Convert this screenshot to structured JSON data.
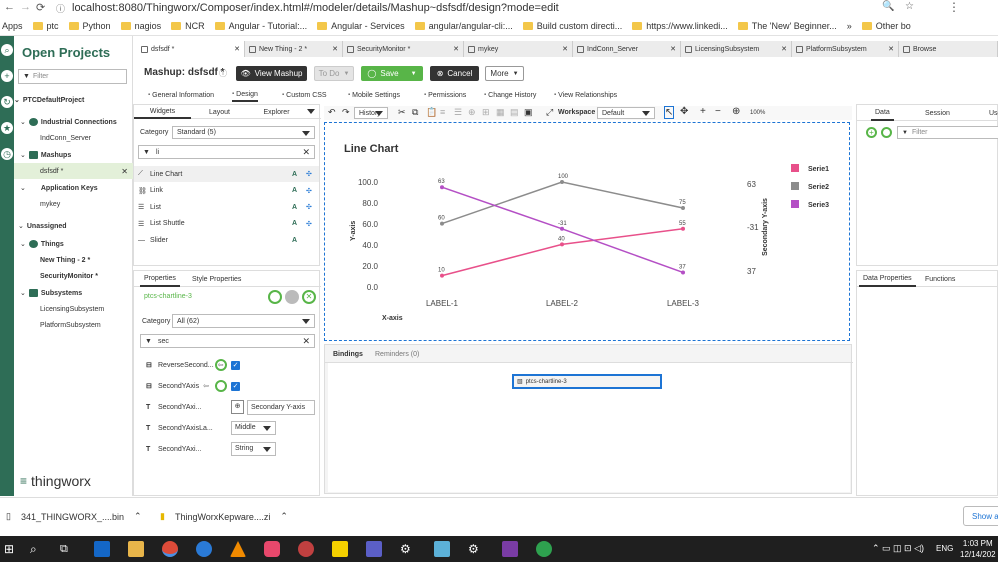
{
  "browser": {
    "url": "localhost:8080/Thingworx/Composer/index.html#/modeler/details/Mashup~dsfsdf/design?mode=edit",
    "bookmarks": [
      "Apps",
      "ptc",
      "Python",
      "nagios",
      "NCR",
      "Angular - Tutorial:...",
      "Angular - Services",
      "angular/angular-cli:...",
      "Build custom directi...",
      "https://www.linkedi...",
      "The 'New' Beginner...",
      "»",
      "Other bo"
    ]
  },
  "project_panel": {
    "title": "Open Projects",
    "filter_placeholder": "Filter",
    "project": "PTCDefaultProject",
    "items": [
      {
        "label": "Industrial Connections",
        "level": 0,
        "bold": true
      },
      {
        "label": "IndConn_Server",
        "level": 1
      },
      {
        "label": "Mashups",
        "level": 0,
        "bold": true
      },
      {
        "label": "dsfsdf *",
        "level": 1,
        "selected": true
      },
      {
        "label": "Application Keys",
        "level": 0,
        "bold": true
      },
      {
        "label": "mykey",
        "level": 1
      },
      {
        "label": "Unassigned",
        "level": -1,
        "bold": true
      },
      {
        "label": "Things",
        "level": 0,
        "bold": true
      },
      {
        "label": "New Thing - 2 *",
        "level": 1,
        "bold": true
      },
      {
        "label": "SecurityMonitor *",
        "level": 1,
        "bold": true
      },
      {
        "label": "Subsystems",
        "level": 0,
        "bold": true
      },
      {
        "label": "LicensingSubsystem",
        "level": 1
      },
      {
        "label": "PlatformSubsystem",
        "level": 1
      }
    ],
    "brand": "thingworx"
  },
  "tabs": [
    "dsfsdf *",
    "New Thing - 2 *",
    "SecurityMonitor *",
    "mykey",
    "IndConn_Server",
    "LicensingSubsystem",
    "PlatformSubsystem",
    "Browse"
  ],
  "toolbar": {
    "title": "Mashup: dsfsdf *",
    "view_mashup": "View Mashup",
    "todo": "To Do",
    "save": "Save",
    "cancel": "Cancel",
    "more": "More"
  },
  "subtabs": [
    "General Information",
    "Design",
    "Custom CSS",
    "Mobile Settings",
    "Permissions",
    "Change History",
    "View Relationships"
  ],
  "widgets_panel": {
    "tabs": [
      "Widgets",
      "Layout",
      "Explorer"
    ],
    "category_label": "Category",
    "category_value": "Standard (5)",
    "search": "li",
    "items": [
      "Line Chart",
      "Link",
      "List",
      "List Shuttle",
      "Slider"
    ]
  },
  "canvas_toolbar": {
    "history": "History",
    "workspace_label": "Workspace",
    "workspace_value": "Default",
    "zoom": "100%"
  },
  "chart_data": {
    "type": "line",
    "title": "Line Chart",
    "xlabel": "X-axis",
    "ylabel": "Y-axis",
    "y2label": "Secondary Y-axis",
    "categories": [
      "LABEL-1",
      "LABEL-2",
      "LABEL-3"
    ],
    "ylim": [
      0,
      100
    ],
    "yticks": [
      "100.0",
      "80.0",
      "60.0",
      "40.0",
      "20.0",
      "0.0"
    ],
    "y2ticks": [
      "63",
      "-31",
      "37"
    ],
    "legend_position": "right",
    "series": [
      {
        "name": "Serie1",
        "color": "#e8508a",
        "values": [
          10,
          40,
          55
        ],
        "labels": [
          "10",
          "40",
          "55"
        ]
      },
      {
        "name": "Serie2",
        "color": "#8c8c8c",
        "values": [
          60,
          100,
          75
        ],
        "labels": [
          "60",
          "100",
          "75"
        ]
      },
      {
        "name": "Serie3",
        "color": "#b44fc5",
        "values": [
          95,
          55,
          13
        ],
        "labels": [
          "63",
          "-31",
          "37"
        ]
      }
    ]
  },
  "bindings": {
    "tabs": [
      "Bindings",
      "Reminders (0)"
    ],
    "widget": "ptcs-chartline-3"
  },
  "properties_panel": {
    "tabs": [
      "Properties",
      "Style Properties"
    ],
    "widget_id": "ptcs-chartline-3",
    "category_label": "Category",
    "category_value": "All (62)",
    "search": "sec",
    "rows": [
      {
        "label": "ReverseSecond...",
        "type": "checkbox"
      },
      {
        "label": "SecondYAxis",
        "type": "checkbox"
      },
      {
        "label": "SecondYAxi...",
        "type": "text",
        "value": "Secondary Y-axis"
      },
      {
        "label": "SecondYAxisLa...",
        "type": "select",
        "value": "Middle"
      },
      {
        "label": "SecondYAxi...",
        "type": "select",
        "value": "String"
      }
    ]
  },
  "right_panel": {
    "tabs": [
      "Data",
      "Session",
      "Use"
    ],
    "filter_placeholder": "Filter",
    "bottom_tabs": [
      "Data Properties",
      "Functions"
    ]
  },
  "downloads": {
    "items": [
      "341_THINGWORX_....bin",
      "ThingWorxKepware....zi"
    ],
    "show_all": "Show a"
  },
  "taskbar": {
    "time": "1:03 PM",
    "date": "12/14/202",
    "lang": "ENG"
  },
  "colors": {
    "green": "#58b548",
    "dark": "#333333",
    "rail": "#2e6d56",
    "accent_blue": "#1d74d4"
  }
}
